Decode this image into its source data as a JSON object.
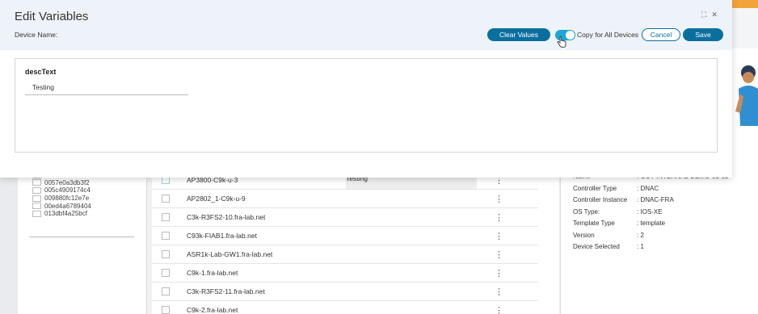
{
  "modal": {
    "title": "Edit Variables",
    "device_label": "Device Name:",
    "clear_button": "Clear Values",
    "toggle_label": "Copy for All Devices",
    "toggle_on": true,
    "cancel_button": "Cancel",
    "save_button": "Save",
    "expand_icon": "⛶",
    "close_icon": "✕",
    "variable": {
      "label": "descText",
      "value": "Testing"
    }
  },
  "left_list": {
    "items": [
      "00533041b50c",
      "0057e0a3db3f2",
      "005c4909174c4",
      "009880fc12e7e",
      "00ed4a6789404",
      "013dbf4a25bcf"
    ]
  },
  "devices": {
    "rows": [
      {
        "hostname": "AP2802_1-C9k-u-9",
        "value": ""
      },
      {
        "hostname": "C3k-R3FS2-10.fra-lab.net",
        "value": ""
      },
      {
        "hostname": "C93k-FIAB1.fra-lab.net",
        "value": ""
      },
      {
        "hostname": "ASR1k-Lab-GW1.fra-lab.net",
        "value": ""
      },
      {
        "hostname": "C9k-1.fra-lab.net",
        "value": ""
      },
      {
        "hostname": "C3k-R3FS2-11.fra-lab.net",
        "value": ""
      },
      {
        "hostname": "C9k-2.fra-lab.net",
        "value": ""
      }
    ],
    "partial_row": {
      "hostname": "AP3800-C9k-u-3",
      "value": "Testing"
    }
  },
  "properties": {
    "items": [
      {
        "key": "Name",
        "value": ": GOT-INTERNAL-DEMO-02-02"
      },
      {
        "key": "Controller Type",
        "value": ": DNAC"
      },
      {
        "key": "Controller Instance",
        "value": ": DNAC-FRA"
      },
      {
        "key": "OS Type:",
        "value": ": IOS-XE"
      },
      {
        "key": "Template Type",
        "value": ": template"
      },
      {
        "key": "Version",
        "value": ": 2"
      },
      {
        "key": "Device Selected",
        "value": ": 1"
      }
    ]
  },
  "colors": {
    "primary": "#0b6f9e",
    "toggle": "#1ea6d8",
    "header_bg": "#eef3f9"
  }
}
